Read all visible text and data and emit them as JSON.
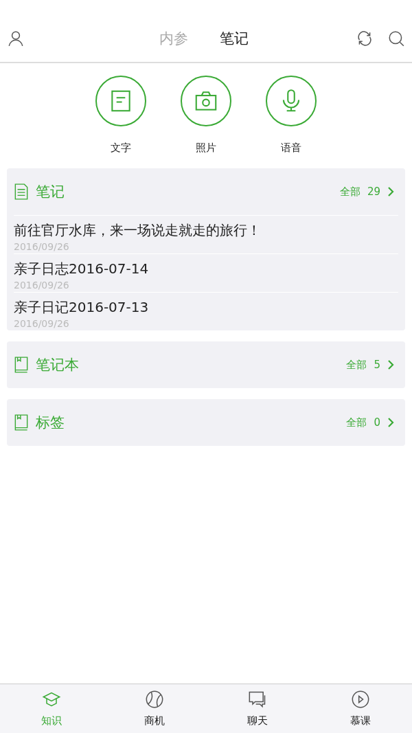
{
  "header": {
    "tabs": [
      {
        "label": "内参",
        "selected": false
      },
      {
        "label": "笔记",
        "selected": true
      }
    ]
  },
  "actions": [
    {
      "kind": "text",
      "label": "文字"
    },
    {
      "kind": "photo",
      "label": "照片"
    },
    {
      "kind": "voice",
      "label": "语音"
    }
  ],
  "sections": [
    {
      "kind": "notes",
      "title": "笔记",
      "all_label": "全部",
      "count": "29",
      "items": [
        {
          "title": "前往官厅水库，来一场说走就走的旅行！",
          "date": "2016/09/26"
        },
        {
          "title": "亲子日志2016-07-14",
          "date": "2016/09/26"
        },
        {
          "title": "亲子日记2016-07-13",
          "date": "2016/09/26"
        }
      ]
    },
    {
      "kind": "book",
      "title": "笔记本",
      "all_label": "全部",
      "count": "5"
    },
    {
      "kind": "book",
      "title": "标签",
      "all_label": "全部",
      "count": "0"
    }
  ],
  "bottom_nav": [
    {
      "kind": "cap",
      "label": "知识",
      "selected": true
    },
    {
      "kind": "ball",
      "label": "商机",
      "selected": false
    },
    {
      "kind": "chat",
      "label": "聊天",
      "selected": false
    },
    {
      "kind": "play",
      "label": "慕课",
      "selected": false
    }
  ]
}
